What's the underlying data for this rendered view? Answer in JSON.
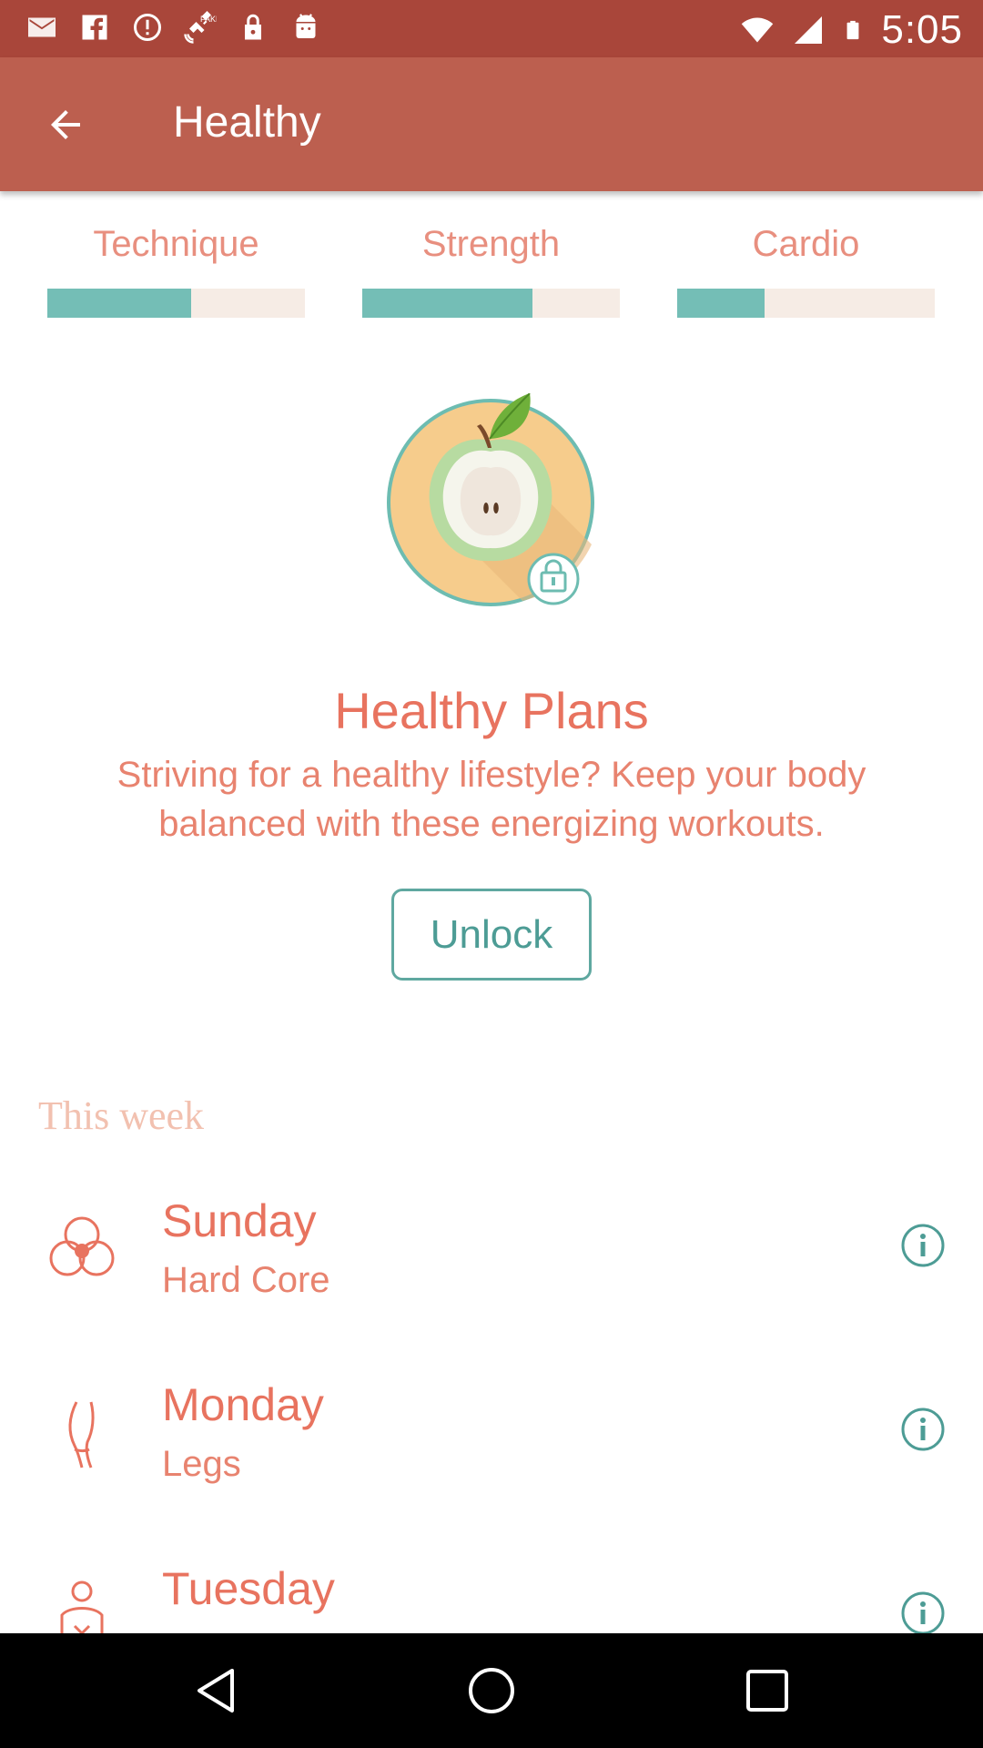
{
  "status_bar": {
    "time": "5:05",
    "left_icons": [
      "email-icon",
      "facebook-icon",
      "alert-icon",
      "satellite-icon",
      "lock-icon",
      "android-icon"
    ],
    "right_icons": [
      "wifi-icon",
      "signal-icon",
      "battery-icon"
    ]
  },
  "app_bar": {
    "title": "Healthy",
    "back_icon": "arrow-back-icon"
  },
  "progress": [
    {
      "label": "Technique",
      "value": 0.56
    },
    {
      "label": "Strength",
      "value": 0.66
    },
    {
      "label": "Cardio",
      "value": 0.34
    }
  ],
  "hero": {
    "icon": "apple-icon",
    "lock_icon": "lock-icon",
    "title": "Healthy Plans",
    "description": "Striving for a healthy lifestyle? Keep your body balanced with these energizing workouts.",
    "unlock_label": "Unlock"
  },
  "week": {
    "header": "This week",
    "days": [
      {
        "day": "Sunday",
        "workout": "Hard Core",
        "icon": "core-icon"
      },
      {
        "day": "Monday",
        "workout": "Legs",
        "icon": "leg-icon"
      },
      {
        "day": "Tuesday",
        "workout": "",
        "icon": "body-icon"
      }
    ]
  },
  "nav_bar": {
    "buttons": [
      "back-triangle-icon",
      "home-circle-icon",
      "recents-square-icon"
    ]
  },
  "colors": {
    "status_bar": "#a9463a",
    "app_bar": "#bc5f4f",
    "accent_coral": "#e8735f",
    "accent_teal": "#74beb6",
    "track": "#f6ece5"
  }
}
